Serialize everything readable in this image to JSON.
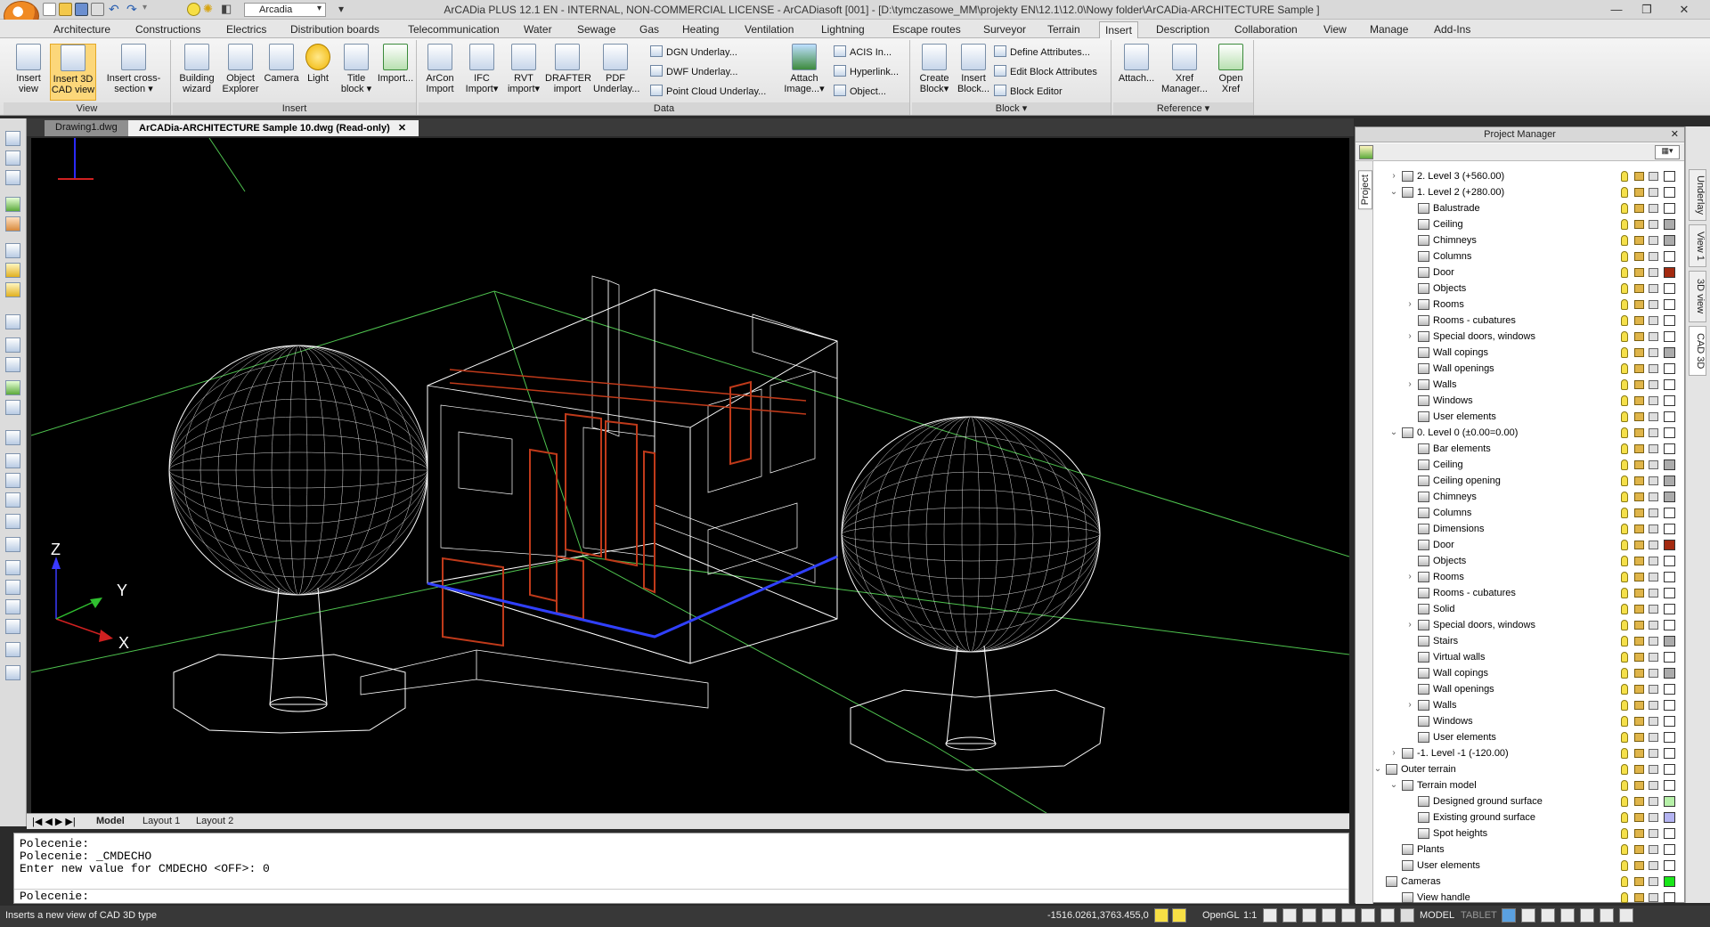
{
  "titlebar": {
    "title": "ArCADia PLUS 12.1 EN - INTERNAL, NON-COMMERCIAL LICENSE - ArCADiasoft [001] - [D:\\tymczasowe_MM\\projekty EN\\12.1\\12.0\\Nowy folder\\ArCADia-ARCHITECTURE Sample ]",
    "workspace": "Arcadia"
  },
  "menu": {
    "tabs": [
      "Architecture",
      "Constructions",
      "Electrics",
      "Distribution boards",
      "Telecommunication",
      "Water",
      "Sewage",
      "Gas",
      "Heating",
      "Ventilation",
      "Lightning",
      "Escape routes",
      "Surveyor",
      "Terrain",
      "Insert",
      "Description",
      "Collaboration",
      "View",
      "Manage",
      "Add-Ins"
    ],
    "active": "Insert"
  },
  "ribbon": {
    "view": {
      "label": "View",
      "buttons": [
        "Insert view",
        "Insert 3D CAD view",
        "Insert cross-section"
      ]
    },
    "insert": {
      "label": "Insert",
      "buttons": [
        "Building wizard",
        "Object Explorer",
        "Camera",
        "Light",
        "Title block",
        "Import..."
      ]
    },
    "data": {
      "label": "Data",
      "buttons": [
        "ArCon Import",
        "IFC Import",
        "RVT import",
        "DRAFTER import",
        "PDF Underlay..."
      ],
      "small": [
        "DGN Underlay...",
        "DWF Underlay...",
        "Point Cloud Underlay..."
      ],
      "attach": "Attach Image...",
      "small2": [
        "ACIS In...",
        "Hyperlink...",
        "Object..."
      ]
    },
    "block": {
      "label": "Block",
      "buttons": [
        "Create Block",
        "Insert Block..."
      ],
      "small": [
        "Define Attributes...",
        "Edit Block Attributes",
        "Block Editor"
      ]
    },
    "reference": {
      "label": "Reference",
      "buttons": [
        "Attach...",
        "Xref Manager...",
        "Open Xref"
      ]
    }
  },
  "doc_tabs": [
    "Drawing1.dwg",
    "ArCADia-ARCHITECTURE Sample 10.dwg (Read-only)"
  ],
  "axes": {
    "z": "Z",
    "y": "Y",
    "x": "X"
  },
  "layout_tabs": [
    "Model",
    "Layout 1",
    "Layout 2"
  ],
  "command": {
    "lines": [
      "Polecenie:",
      "Polecenie: _CMDECHO",
      "Enter new value for CMDECHO <OFF>: 0"
    ],
    "prompt": "Polecenie:"
  },
  "status": {
    "hint": "Inserts a new view of CAD 3D type",
    "coords": "-1516.0261,3763.455,0",
    "render": "OpenGL",
    "scale": "1:1",
    "model": "MODEL",
    "tablet": "TABLET"
  },
  "project_manager": {
    "title": "Project Manager",
    "side_tab": "Project",
    "rows": [
      {
        "indent": 1,
        "exp": "›",
        "label": "2. Level 3 (+560.00)",
        "color": "#ffffff"
      },
      {
        "indent": 1,
        "exp": "⌄",
        "label": "1. Level 2 (+280.00)",
        "color": "#ffffff"
      },
      {
        "indent": 2,
        "exp": "",
        "label": "Balustrade",
        "color": "#ffffff"
      },
      {
        "indent": 2,
        "exp": "",
        "label": "Ceiling",
        "color": "#ababab"
      },
      {
        "indent": 2,
        "exp": "",
        "label": "Chimneys",
        "color": "#ababab"
      },
      {
        "indent": 2,
        "exp": "",
        "label": "Columns",
        "color": "#ffffff"
      },
      {
        "indent": 2,
        "exp": "",
        "label": "Door",
        "color": "#a32a10"
      },
      {
        "indent": 2,
        "exp": "",
        "label": "Objects",
        "color": "#ffffff"
      },
      {
        "indent": 2,
        "exp": "›",
        "label": "Rooms",
        "color": "#ffffff"
      },
      {
        "indent": 2,
        "exp": "",
        "label": "Rooms - cubatures",
        "color": "#ffffff"
      },
      {
        "indent": 2,
        "exp": "›",
        "label": "Special doors, windows",
        "color": "#ffffff"
      },
      {
        "indent": 2,
        "exp": "",
        "label": "Wall copings",
        "color": "#ababab"
      },
      {
        "indent": 2,
        "exp": "",
        "label": "Wall openings",
        "color": "#ffffff"
      },
      {
        "indent": 2,
        "exp": "›",
        "label": "Walls",
        "color": "#ffffff"
      },
      {
        "indent": 2,
        "exp": "",
        "label": "Windows",
        "color": "#ffffff"
      },
      {
        "indent": 2,
        "exp": "",
        "label": "User elements",
        "color": "#ffffff"
      },
      {
        "indent": 1,
        "exp": "⌄",
        "label": "0. Level 0 (±0.00=0.00)",
        "color": "#ffffff"
      },
      {
        "indent": 2,
        "exp": "",
        "label": "Bar elements",
        "color": "#ffffff"
      },
      {
        "indent": 2,
        "exp": "",
        "label": "Ceiling",
        "color": "#ababab"
      },
      {
        "indent": 2,
        "exp": "",
        "label": "Ceiling opening",
        "color": "#ababab"
      },
      {
        "indent": 2,
        "exp": "",
        "label": "Chimneys",
        "color": "#ababab"
      },
      {
        "indent": 2,
        "exp": "",
        "label": "Columns",
        "color": "#ffffff"
      },
      {
        "indent": 2,
        "exp": "",
        "label": "Dimensions",
        "color": "#ffffff"
      },
      {
        "indent": 2,
        "exp": "",
        "label": "Door",
        "color": "#a32a10"
      },
      {
        "indent": 2,
        "exp": "",
        "label": "Objects",
        "color": "#ffffff"
      },
      {
        "indent": 2,
        "exp": "›",
        "label": "Rooms",
        "color": "#ffffff"
      },
      {
        "indent": 2,
        "exp": "",
        "label": "Rooms - cubatures",
        "color": "#ffffff"
      },
      {
        "indent": 2,
        "exp": "",
        "label": "Solid",
        "color": "#ffffff"
      },
      {
        "indent": 2,
        "exp": "›",
        "label": "Special doors, windows",
        "color": "#ffffff"
      },
      {
        "indent": 2,
        "exp": "",
        "label": "Stairs",
        "color": "#ababab"
      },
      {
        "indent": 2,
        "exp": "",
        "label": "Virtual walls",
        "color": "#ffffff"
      },
      {
        "indent": 2,
        "exp": "",
        "label": "Wall copings",
        "color": "#ababab"
      },
      {
        "indent": 2,
        "exp": "",
        "label": "Wall openings",
        "color": "#ffffff"
      },
      {
        "indent": 2,
        "exp": "›",
        "label": "Walls",
        "color": "#ffffff"
      },
      {
        "indent": 2,
        "exp": "",
        "label": "Windows",
        "color": "#ffffff"
      },
      {
        "indent": 2,
        "exp": "",
        "label": "User elements",
        "color": "#ffffff"
      },
      {
        "indent": 1,
        "exp": "›",
        "label": "-1. Level -1 (-120.00)",
        "color": "#ffffff"
      },
      {
        "indent": 0,
        "exp": "⌄",
        "label": "Outer terrain",
        "color": "#ffffff"
      },
      {
        "indent": 1,
        "exp": "⌄",
        "label": "Terrain model",
        "color": "#ffffff"
      },
      {
        "indent": 2,
        "exp": "",
        "label": "Designed ground surface",
        "color": "#b6f0a8"
      },
      {
        "indent": 2,
        "exp": "",
        "label": "Existing ground surface",
        "color": "#b4b4f2"
      },
      {
        "indent": 2,
        "exp": "",
        "label": "Spot heights",
        "color": "#ffffff"
      },
      {
        "indent": 1,
        "exp": "",
        "label": "Plants",
        "color": "#ffffff"
      },
      {
        "indent": 1,
        "exp": "",
        "label": "User elements",
        "color": "#ffffff"
      },
      {
        "indent": 0,
        "exp": "",
        "label": "Cameras",
        "color": "#19e619"
      },
      {
        "indent": 1,
        "exp": "",
        "label": "View handle",
        "color": "#ffffff"
      }
    ]
  },
  "right_tabs": [
    "Underlay",
    "View 1",
    "3D view",
    "CAD 3D"
  ]
}
